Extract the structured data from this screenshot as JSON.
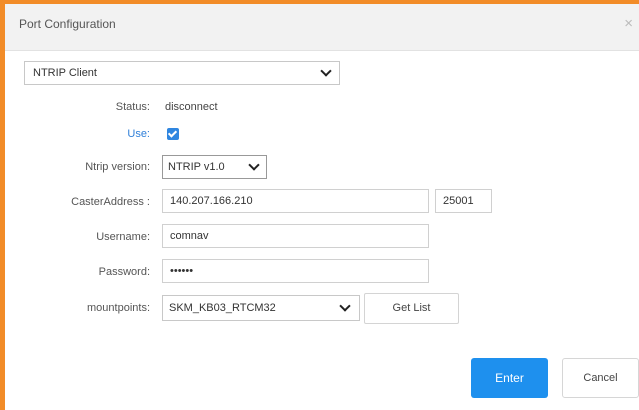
{
  "window": {
    "title": "Port Configuration",
    "close_glyph": "×"
  },
  "port_type": {
    "selected": "NTRIP Client"
  },
  "status": {
    "label": "Status:",
    "value": "disconnect"
  },
  "use": {
    "label": "Use:",
    "checked": true
  },
  "ntrip_version": {
    "label": "Ntrip version:",
    "selected": "NTRIP v1.0"
  },
  "caster": {
    "label": "CasterAddress :",
    "address": "140.207.166.210",
    "port": "25001"
  },
  "username": {
    "label": "Username:",
    "value": "comnav"
  },
  "password": {
    "label": "Password:",
    "value": "••••••"
  },
  "mountpoints": {
    "label": "mountpoints:",
    "selected": "SKM_KB03_RTCM32",
    "get_list_label": "Get List"
  },
  "buttons": {
    "enter": "Enter",
    "cancel": "Cancel"
  },
  "colors": {
    "accent_border": "#f28c28",
    "primary_button": "#1e90ee",
    "use_label": "#2f7fd8"
  },
  "icons": {
    "close": "close-icon",
    "dropdown": "chevron-down-icon",
    "checkbox": "checkbox-checked-icon"
  }
}
